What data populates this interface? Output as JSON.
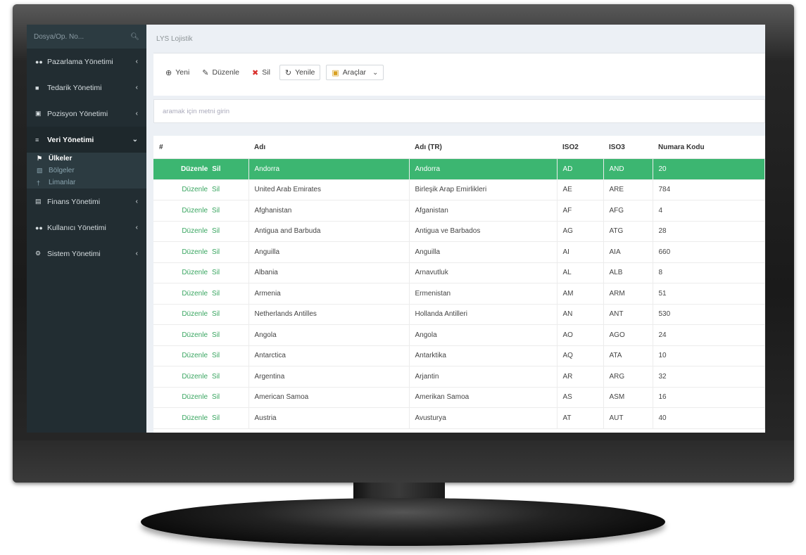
{
  "sidebar": {
    "search_placeholder": "Dosya/Op. No...",
    "items": [
      {
        "icon": "users-icon",
        "label": "Pazarlama Yönetimi",
        "chevron": "‹"
      },
      {
        "icon": "truck-icon",
        "label": "Tedarik Yönetimi",
        "chevron": "‹"
      },
      {
        "icon": "briefcase-icon",
        "label": "Pozisyon Yönetimi",
        "chevron": "‹"
      },
      {
        "icon": "database-icon",
        "label": "Veri Yönetimi",
        "chevron": "⌄"
      },
      {
        "icon": "money-icon",
        "label": "Finans Yönetimi",
        "chevron": "‹"
      },
      {
        "icon": "users-icon",
        "label": "Kullanıcı Yönetimi",
        "chevron": "‹"
      },
      {
        "icon": "cogs-icon",
        "label": "Sistem Yönetimi",
        "chevron": "‹"
      }
    ],
    "sub_items": [
      {
        "icon": "flag-icon",
        "label": "Ülkeler"
      },
      {
        "icon": "map-icon",
        "label": "Bölgeler"
      },
      {
        "icon": "pin-icon",
        "label": "Limanlar"
      }
    ]
  },
  "header": {
    "title": "LYS Lojistik"
  },
  "toolbar": {
    "new_label": "Yeni",
    "edit_label": "Düzenle",
    "delete_label": "Sil",
    "refresh_label": "Yenile",
    "tools_label": "Araçlar"
  },
  "search": {
    "placeholder": "aramak için metni girin"
  },
  "table": {
    "columns": [
      "#",
      "Adı",
      "Adı (TR)",
      "ISO2",
      "ISO3",
      "Numara Kodu"
    ],
    "action_edit": "Düzenle",
    "action_delete": "Sil",
    "rows": [
      [
        "Andorra",
        "Andorra",
        "AD",
        "AND",
        "20"
      ],
      [
        "United Arab Emirates",
        "Birleşik Arap Emirlikleri",
        "AE",
        "ARE",
        "784"
      ],
      [
        "Afghanistan",
        "Afganistan",
        "AF",
        "AFG",
        "4"
      ],
      [
        "Antigua and Barbuda",
        "Antigua ve Barbados",
        "AG",
        "ATG",
        "28"
      ],
      [
        "Anguilla",
        "Anguilla",
        "AI",
        "AIA",
        "660"
      ],
      [
        "Albania",
        "Arnavutluk",
        "AL",
        "ALB",
        "8"
      ],
      [
        "Armenia",
        "Ermenistan",
        "AM",
        "ARM",
        "51"
      ],
      [
        "Netherlands Antilles",
        "Hollanda Antilleri",
        "AN",
        "ANT",
        "530"
      ],
      [
        "Angola",
        "Angola",
        "AO",
        "AGO",
        "24"
      ],
      [
        "Antarctica",
        "Antarktika",
        "AQ",
        "ATA",
        "10"
      ],
      [
        "Argentina",
        "Arjantin",
        "AR",
        "ARG",
        "32"
      ],
      [
        "American Samoa",
        "Amerikan Samoa",
        "AS",
        "ASM",
        "16"
      ],
      [
        "Austria",
        "Avusturya",
        "AT",
        "AUT",
        "40"
      ]
    ]
  },
  "colors": {
    "sidebar_bg": "#222d32",
    "selected_row": "#3cb671",
    "action_link": "#3aa661",
    "delete_icon": "#d9302c"
  }
}
